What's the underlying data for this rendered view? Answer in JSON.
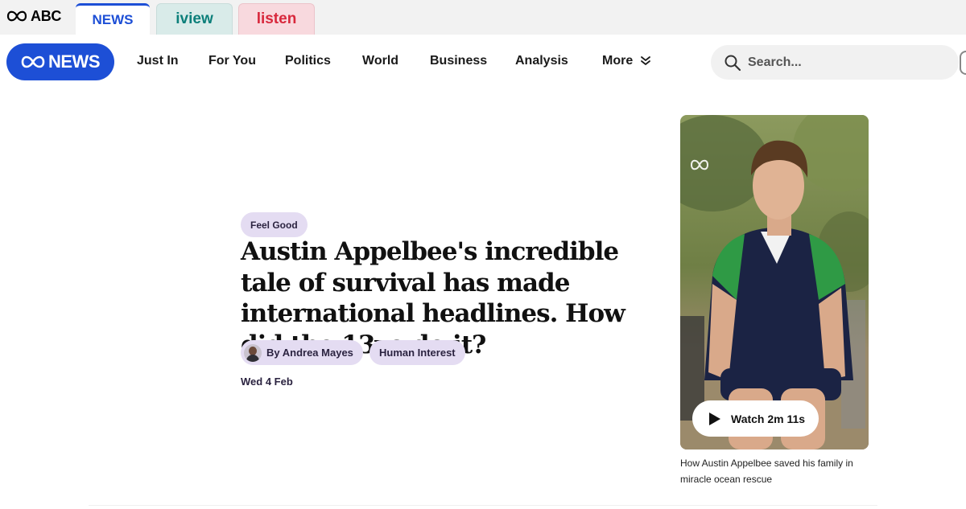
{
  "network": {
    "brand": "ABC",
    "tabs": [
      {
        "label": "NEWS"
      },
      {
        "label": "iview"
      },
      {
        "label": "listen"
      }
    ]
  },
  "nav": {
    "logo_text": "NEWS",
    "items": [
      {
        "label": "Just In"
      },
      {
        "label": "For You"
      },
      {
        "label": "Politics"
      },
      {
        "label": "World"
      },
      {
        "label": "Business"
      },
      {
        "label": "Analysis"
      }
    ],
    "more_label": "More",
    "search_placeholder": "Search..."
  },
  "article": {
    "tag": "Feel Good",
    "headline": "Austin Appelbee's incredible tale of survival has made international headlines. How did the 13yo do it?",
    "byline": "By Andrea Mayes",
    "topic": "Human Interest",
    "date": "Wed 4 Feb"
  },
  "video": {
    "watch_label": "Watch 2m 11s",
    "caption": "How Austin Appelbee saved his family in miracle ocean rescue"
  },
  "colors": {
    "brand_blue": "#1d4fd6",
    "iview_teal": "#0c7f7a",
    "listen_red": "#d8283c",
    "pill_lavender": "#e4dcf2"
  }
}
